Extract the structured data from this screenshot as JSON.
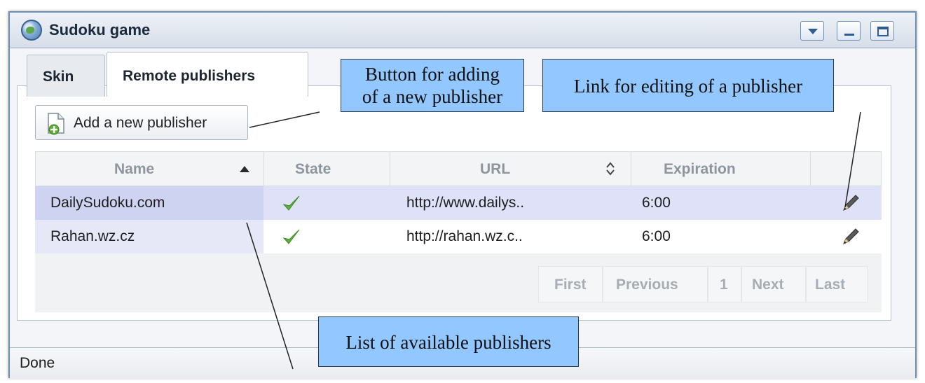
{
  "window": {
    "title": "Sudoku game"
  },
  "tabs": [
    {
      "label": "Skin"
    },
    {
      "label": "Remote publishers"
    }
  ],
  "toolbar": {
    "add_button_label": "Add a new publisher"
  },
  "table": {
    "columns": [
      "Name",
      "State",
      "URL",
      "Expiration",
      ""
    ],
    "sort": {
      "column": "Name",
      "direction": "ascending"
    },
    "rows": [
      {
        "name": "DailySudoku.com",
        "state": "checkmark",
        "url": "http://www.dailys..",
        "expiration": "6:00",
        "action": "pencil-edit"
      },
      {
        "name": "Rahan.wz.cz",
        "state": "checkmark",
        "url": "http://rahan.wz.c..",
        "expiration": "6:00",
        "action": "pencil-edit"
      }
    ],
    "pager": {
      "first": "First",
      "previous": "Previous",
      "page": "1",
      "next": "Next",
      "last": "Last"
    }
  },
  "status": {
    "text": "Done"
  },
  "annotations": {
    "add_button_line1": "Button for adding",
    "add_button_line2": "of a new publisher",
    "edit_link": "Link for editing of a publisher",
    "list": "List of available publishers"
  },
  "colors": {
    "callout_fill": "#93c7ff",
    "selected_row": "#dfe1f8",
    "check_green": "#5fae3a"
  }
}
